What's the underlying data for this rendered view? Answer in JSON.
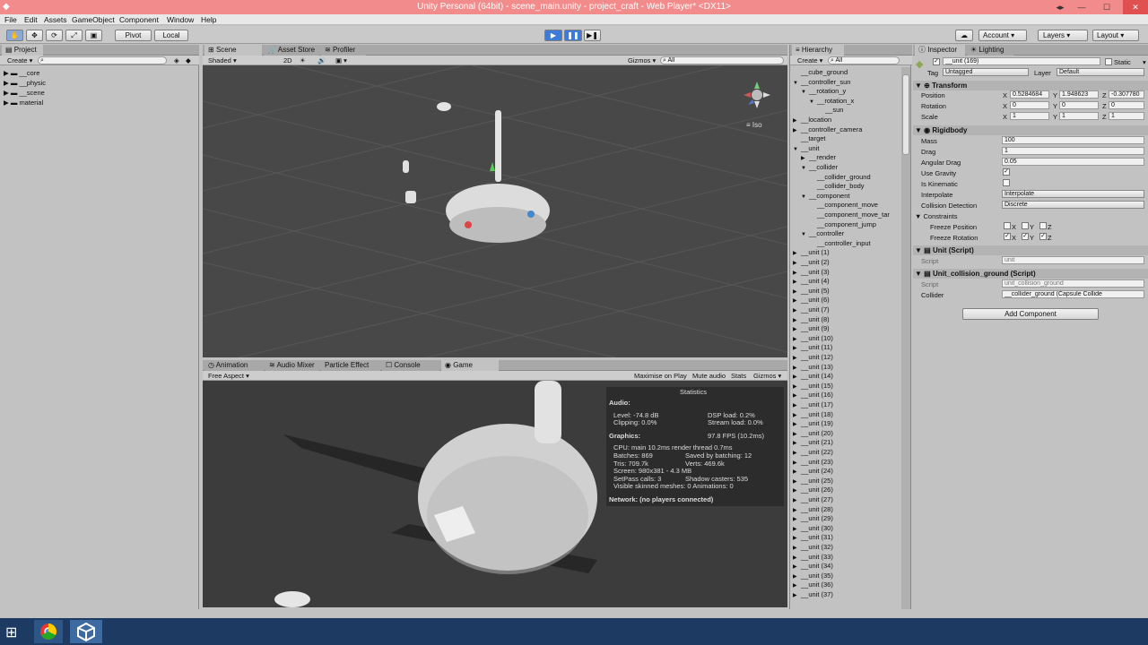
{
  "window": {
    "title": "Unity Personal (64bit) - scene_main.unity - project_craft - Web Player* <DX11>",
    "controls": [
      "◂▸",
      "—",
      "☐",
      "✕"
    ]
  },
  "menu": [
    "File",
    "Edit",
    "Assets",
    "GameObject",
    "Component",
    "Window",
    "Help"
  ],
  "toolbar": {
    "pivot_label": "Pivot",
    "local_label": "Local",
    "account_label": "Account",
    "layers_label": "Layers",
    "layout_label": "Layout"
  },
  "project": {
    "tab_label": "Project",
    "create_label": "Create",
    "folders": [
      "__core",
      "__physic",
      "__scene",
      "material"
    ]
  },
  "scene": {
    "tabs": [
      "Scene",
      "Asset Store",
      "Profiler"
    ],
    "shaded_label": "Shaded",
    "mode_2d_label": "2D",
    "gizmos_label": "Gizmos",
    "search_placeholder": "All",
    "iso_label": "Iso"
  },
  "game": {
    "tabs": [
      "Animation",
      "Audio Mixer",
      "Particle Effect",
      "Console",
      "Game"
    ],
    "aspect_label": "Free Aspect",
    "buttons": [
      "Maximise on Play",
      "Mute audio",
      "Stats",
      "Gizmos"
    ]
  },
  "stats": {
    "title": "Statistics",
    "audio_header": "Audio:",
    "level": "Level: -74.8 dB",
    "clipping": "Clipping: 0.0%",
    "dsp": "DSP load: 0.2%",
    "stream": "Stream load: 0.0%",
    "graphics_header": "Graphics:",
    "fps": "97.8 FPS (10.2ms)",
    "cpu": "CPU: main 10.2ms  render thread 0.7ms",
    "batches": "Batches: 869",
    "saved": "Saved by batching: 12",
    "tris": "Tris: 709.7k",
    "verts": "Verts: 469.6k",
    "screen": "Screen: 980x381 - 4.3 MB",
    "setpass": "SetPass calls: 3",
    "shadow": "Shadow casters: 535",
    "skinned": "Visible skinned meshes: 0  Animations: 0",
    "network": "Network: (no players connected)"
  },
  "hierarchy": {
    "tab_label": "Hierarchy",
    "create_label": "Create",
    "search_placeholder": "All",
    "items": [
      {
        "label": "__cube_ground",
        "indent": 0,
        "arrow": ""
      },
      {
        "label": "__controller_sun",
        "indent": 0,
        "arrow": "▼"
      },
      {
        "label": "__rotation_y",
        "indent": 1,
        "arrow": "▼"
      },
      {
        "label": "__rotation_x",
        "indent": 2,
        "arrow": "▼"
      },
      {
        "label": "__sun",
        "indent": 3,
        "arrow": ""
      },
      {
        "label": "__location",
        "indent": 0,
        "arrow": "▶"
      },
      {
        "label": "__controller_camera",
        "indent": 0,
        "arrow": "▶"
      },
      {
        "label": "__target",
        "indent": 0,
        "arrow": ""
      },
      {
        "label": "__unit",
        "indent": 0,
        "arrow": "▼"
      },
      {
        "label": "__render",
        "indent": 1,
        "arrow": "▶"
      },
      {
        "label": "__collider",
        "indent": 1,
        "arrow": "▼"
      },
      {
        "label": "__collider_ground",
        "indent": 2,
        "arrow": ""
      },
      {
        "label": "__collider_body",
        "indent": 2,
        "arrow": ""
      },
      {
        "label": "__component",
        "indent": 1,
        "arrow": "▼"
      },
      {
        "label": "__component_move",
        "indent": 2,
        "arrow": ""
      },
      {
        "label": "__component_move_tar",
        "indent": 2,
        "arrow": ""
      },
      {
        "label": "__component_jump",
        "indent": 2,
        "arrow": ""
      },
      {
        "label": "__controller",
        "indent": 1,
        "arrow": "▼"
      },
      {
        "label": "__controller_input",
        "indent": 2,
        "arrow": ""
      },
      {
        "label": "__unit (1)",
        "indent": 0,
        "arrow": "▶"
      },
      {
        "label": "__unit (2)",
        "indent": 0,
        "arrow": "▶"
      },
      {
        "label": "__unit (3)",
        "indent": 0,
        "arrow": "▶"
      },
      {
        "label": "__unit (4)",
        "indent": 0,
        "arrow": "▶"
      },
      {
        "label": "__unit (5)",
        "indent": 0,
        "arrow": "▶"
      },
      {
        "label": "__unit (6)",
        "indent": 0,
        "arrow": "▶"
      },
      {
        "label": "__unit (7)",
        "indent": 0,
        "arrow": "▶"
      },
      {
        "label": "__unit (8)",
        "indent": 0,
        "arrow": "▶"
      },
      {
        "label": "__unit (9)",
        "indent": 0,
        "arrow": "▶"
      },
      {
        "label": "__unit (10)",
        "indent": 0,
        "arrow": "▶"
      },
      {
        "label": "__unit (11)",
        "indent": 0,
        "arrow": "▶"
      },
      {
        "label": "__unit (12)",
        "indent": 0,
        "arrow": "▶"
      },
      {
        "label": "__unit (13)",
        "indent": 0,
        "arrow": "▶"
      },
      {
        "label": "__unit (14)",
        "indent": 0,
        "arrow": "▶"
      },
      {
        "label": "__unit (15)",
        "indent": 0,
        "arrow": "▶"
      },
      {
        "label": "__unit (16)",
        "indent": 0,
        "arrow": "▶"
      },
      {
        "label": "__unit (17)",
        "indent": 0,
        "arrow": "▶"
      },
      {
        "label": "__unit (18)",
        "indent": 0,
        "arrow": "▶"
      },
      {
        "label": "__unit (19)",
        "indent": 0,
        "arrow": "▶"
      },
      {
        "label": "__unit (20)",
        "indent": 0,
        "arrow": "▶"
      },
      {
        "label": "__unit (21)",
        "indent": 0,
        "arrow": "▶"
      },
      {
        "label": "__unit (22)",
        "indent": 0,
        "arrow": "▶"
      },
      {
        "label": "__unit (23)",
        "indent": 0,
        "arrow": "▶"
      },
      {
        "label": "__unit (24)",
        "indent": 0,
        "arrow": "▶"
      },
      {
        "label": "__unit (25)",
        "indent": 0,
        "arrow": "▶"
      },
      {
        "label": "__unit (26)",
        "indent": 0,
        "arrow": "▶"
      },
      {
        "label": "__unit (27)",
        "indent": 0,
        "arrow": "▶"
      },
      {
        "label": "__unit (28)",
        "indent": 0,
        "arrow": "▶"
      },
      {
        "label": "__unit (29)",
        "indent": 0,
        "arrow": "▶"
      },
      {
        "label": "__unit (30)",
        "indent": 0,
        "arrow": "▶"
      },
      {
        "label": "__unit (31)",
        "indent": 0,
        "arrow": "▶"
      },
      {
        "label": "__unit (32)",
        "indent": 0,
        "arrow": "▶"
      },
      {
        "label": "__unit (33)",
        "indent": 0,
        "arrow": "▶"
      },
      {
        "label": "__unit (34)",
        "indent": 0,
        "arrow": "▶"
      },
      {
        "label": "__unit (35)",
        "indent": 0,
        "arrow": "▶"
      },
      {
        "label": "__unit (36)",
        "indent": 0,
        "arrow": "▶"
      },
      {
        "label": "__unit (37)",
        "indent": 0,
        "arrow": "▶"
      }
    ]
  },
  "inspector": {
    "tab_label": "Inspector",
    "lighting_tab": "Lighting",
    "object_name": "__unit (169)",
    "static_label": "Static",
    "tag_label": "Tag",
    "tag_value": "Untagged",
    "layer_label": "Layer",
    "layer_value": "Default",
    "transform": {
      "header": "Transform",
      "position_label": "Position",
      "rotation_label": "Rotation",
      "scale_label": "Scale",
      "position": [
        "0.5284684",
        "1.948623",
        "-0.307780"
      ],
      "rotation": [
        "0",
        "0",
        "0"
      ],
      "scale": [
        "1",
        "1",
        "1"
      ]
    },
    "rigidbody": {
      "header": "Rigidbody",
      "mass_label": "Mass",
      "mass": "100",
      "drag_label": "Drag",
      "drag": "1",
      "angular_drag_label": "Angular Drag",
      "angular_drag": "0.05",
      "use_gravity_label": "Use Gravity",
      "is_kinematic_label": "Is Kinematic",
      "interpolate_label": "Interpolate",
      "interpolate": "Interpolate",
      "collision_label": "Collision Detection",
      "collision": "Discrete",
      "constraints_label": "Constraints",
      "freeze_position_label": "Freeze Position",
      "freeze_rotation_label": "Freeze Rotation",
      "axes": [
        "X",
        "Y",
        "Z"
      ]
    },
    "unit_script": {
      "header": "Unit (Script)",
      "script_label": "Script",
      "script_value": "unit"
    },
    "collision_script": {
      "header": "Unit_collision_ground (Script)",
      "script_label": "Script",
      "script_value": "unit_collision_ground",
      "collider_label": "Collider",
      "collider_value": "__collider_ground (Capsule Collide"
    },
    "add_component_label": "Add Component"
  },
  "colors": {
    "titlebar": "#f28c8c",
    "panel": "#c2c2c2",
    "play_accent": "#3d7bd8",
    "scene_bg": "#484848",
    "taskbar": "#1d3a63"
  }
}
